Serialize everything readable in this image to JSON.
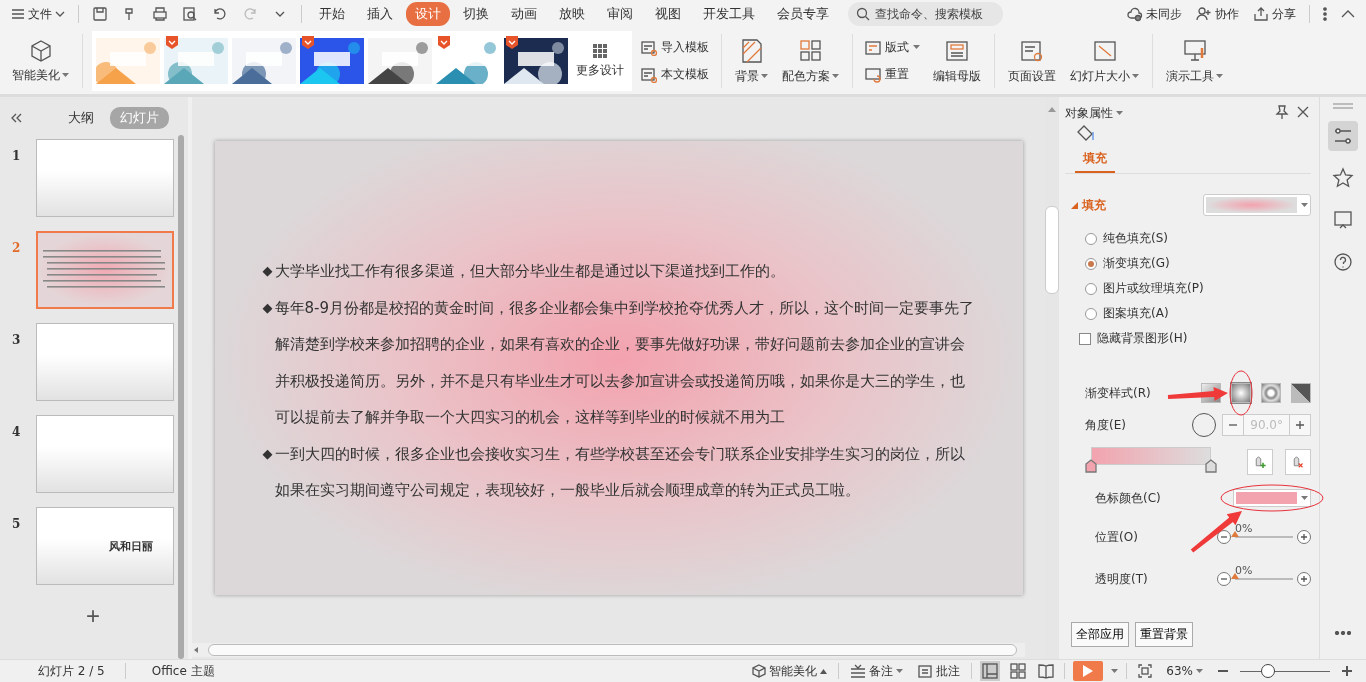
{
  "title_bar": {
    "file_menu": "文件",
    "tabs": [
      {
        "label": "开始",
        "selected": false
      },
      {
        "label": "插入",
        "selected": false
      },
      {
        "label": "设计",
        "selected": true
      },
      {
        "label": "切换",
        "selected": false
      },
      {
        "label": "动画",
        "selected": false
      },
      {
        "label": "放映",
        "selected": false
      },
      {
        "label": "审阅",
        "selected": false
      },
      {
        "label": "视图",
        "selected": false
      },
      {
        "label": "开发工具",
        "selected": false
      },
      {
        "label": "会员专享",
        "selected": false
      }
    ],
    "search": {
      "placeholder": "查找命令、搜索模板"
    },
    "actions": [
      {
        "kind": "sync",
        "label": "未同步"
      },
      {
        "kind": "share-user",
        "label": "协作"
      },
      {
        "kind": "share",
        "label": "分享"
      }
    ]
  },
  "ribbon": {
    "smart": {
      "label": "智能美化"
    },
    "templates": [
      {
        "kind": "picture",
        "vip": false
      },
      {
        "kind": "picture",
        "vip": true
      },
      {
        "kind": "picture",
        "vip": false
      },
      {
        "kind": "picture",
        "vip": true
      },
      {
        "kind": "picture",
        "vip": false
      },
      {
        "kind": "picture",
        "vip": true
      },
      {
        "kind": "picture",
        "vip": true
      }
    ],
    "more": "更多设计",
    "import": [
      "导入模板",
      "本文模板"
    ],
    "tools": [
      {
        "kind": "background",
        "label": "背景",
        "dropdown": true
      },
      {
        "kind": "palette",
        "label": "配色方案",
        "dropdown": true
      }
    ],
    "layout": [
      {
        "kind": "layout",
        "label": "版式",
        "dropdown": true
      },
      {
        "kind": "reset",
        "label": "重置",
        "dropdown": false
      }
    ],
    "tools2": [
      {
        "kind": "master",
        "label": "编辑母版",
        "dropdown": false
      },
      {
        "kind": "page",
        "label": "页面设置",
        "dropdown": false
      },
      {
        "kind": "size",
        "label": "幻灯片大小",
        "dropdown": true
      },
      {
        "kind": "present",
        "label": "演示工具",
        "dropdown": true
      }
    ]
  },
  "left_panel": {
    "tabs": [
      {
        "label": "大纲",
        "selected": false
      },
      {
        "label": "幻灯片",
        "selected": true
      }
    ],
    "slides": [
      {
        "number": "1",
        "selected": false,
        "kind": "blank"
      },
      {
        "number": "2",
        "selected": true,
        "kind": "text"
      },
      {
        "number": "3",
        "selected": false,
        "kind": "blank"
      },
      {
        "number": "4",
        "selected": false,
        "kind": "blank"
      },
      {
        "number": "5",
        "selected": false,
        "kind": "title",
        "title": "风和日丽"
      }
    ],
    "add_button": "+"
  },
  "slide": {
    "paragraphs": [
      {
        "bullet": "◆",
        "text": "大学毕业找工作有很多渠道，但大部分毕业生都是通过以下渠道找到工作的。"
      },
      {
        "bullet": "◆",
        "text": "每年8-9月份都是校招的黄金时间，很多企业都会集中到学校抢夺优秀人才，所以，这个时间一定要事先了解清楚到学校来参加招聘的企业，如果有喜欢的企业，要事先做好功课，带好问题前去参加企业的宣讲会并积极投递简历。另外，并不是只有毕业生才可以去参加宣讲会或投递简历哦，如果你是大三的学生，也可以提前去了解并争取一个大四实习的机会，这样等到毕业的时候就不用为工"
      },
      {
        "bullet": "◆",
        "text": "一到大四的时候，很多企业也会接收实习生，有些学校甚至还会专门联系企业安排学生实习的岗位，所以如果在实习期间遵守公司规定，表现较好，一般毕业后就会顺理成章的转为正式员工啦。"
      }
    ]
  },
  "properties": {
    "title": "对象属性",
    "tab": "填充",
    "section": "填充",
    "fill_options": [
      {
        "label": "纯色填充(S)",
        "selected": false
      },
      {
        "label": "渐变填充(G)",
        "selected": true
      },
      {
        "label": "图片或纹理填充(P)",
        "selected": false
      },
      {
        "label": "图案填充(A)",
        "selected": false
      }
    ],
    "hide_background": {
      "label": "隐藏背景图形(H)",
      "checked": false
    },
    "gradient_style": {
      "label": "渐变样式(R)",
      "styles": [
        {
          "kind": "linear",
          "selected": false,
          "highlighted": false
        },
        {
          "kind": "radial",
          "selected": true,
          "highlighted": true
        },
        {
          "kind": "rect",
          "selected": false,
          "highlighted": false
        },
        {
          "kind": "path",
          "selected": false,
          "highlighted": false
        }
      ]
    },
    "angle": {
      "label": "角度(E)",
      "value": "90.0°",
      "disabled": true
    },
    "stop_color": {
      "label": "色标颜色(C)",
      "color": "#f2a3ae",
      "highlighted": true
    },
    "sliders": [
      {
        "label": "位置(O)",
        "reading": "0%",
        "level": 0
      },
      {
        "label": "透明度(T)",
        "reading": "0%",
        "level": 0
      }
    ],
    "buttons": [
      "全部应用",
      "重置背景"
    ]
  },
  "status_bar": {
    "slide": "幻灯片 2 / 5",
    "theme": "Office 主题",
    "smart": "智能美化",
    "notes": "备注",
    "comments": "批注",
    "views": [
      {
        "kind": "normal",
        "selected": true
      },
      {
        "kind": "sorter",
        "selected": false
      },
      {
        "kind": "reading",
        "selected": false
      }
    ],
    "zoom": "63%",
    "zoom_slider": {
      "level": 0.3
    }
  }
}
